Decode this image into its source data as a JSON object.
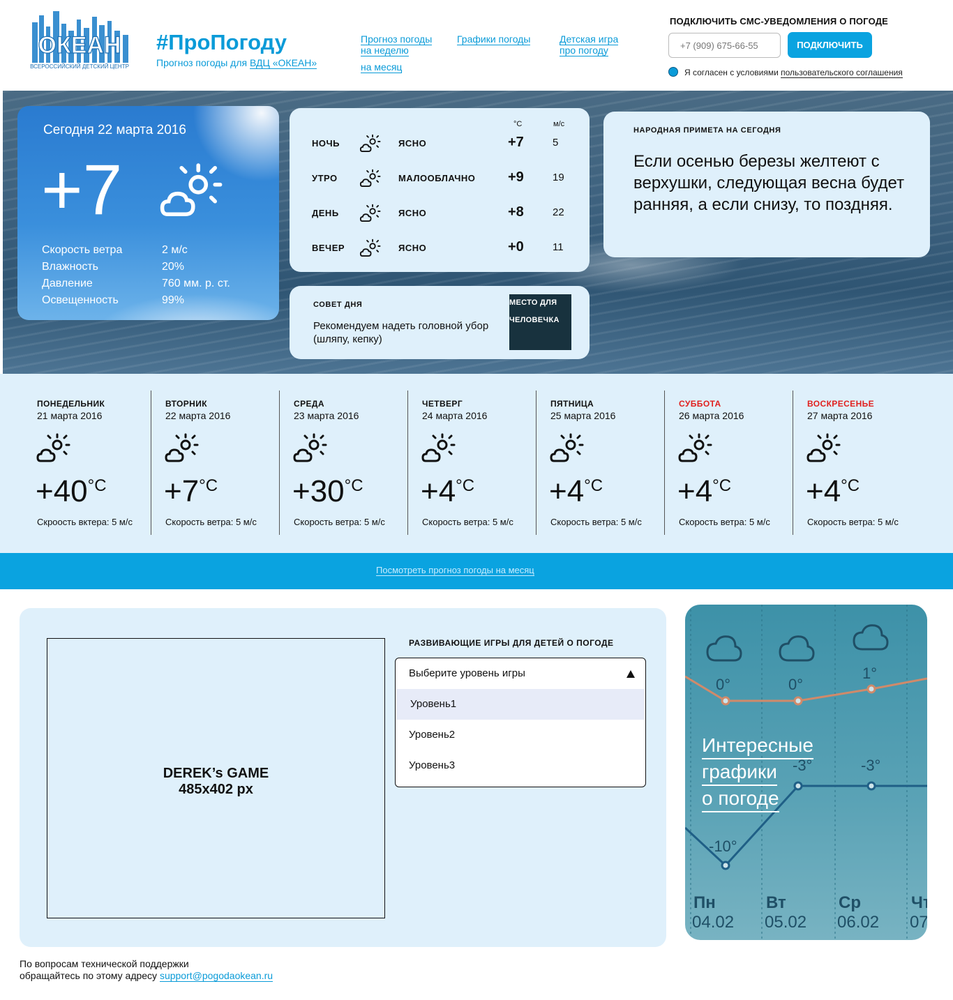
{
  "header": {
    "logo_text": "ОКЕАН",
    "logo_sub": "ВСЕРОССИЙСКИЙ ДЕТСКИЙ ЦЕНТР",
    "hashtag": "#ПроПогоду",
    "subtitle_prefix": "Прогноз погоды для",
    "subtitle_link": "ВДЦ «ОКЕАН»",
    "nav": {
      "week_1": "Прогноз погоды",
      "week_2": "на неделю",
      "month": "на месяц",
      "charts": "Графики погоды",
      "game_1": "Детская игра",
      "game_2": "про погоду"
    },
    "sms": {
      "title": "ПОДКЛЮЧИТЬ СМС-УВЕДОМЛЕНИЯ О ПОГОДЕ",
      "phone_placeholder": "+7 (909) 675-66-55",
      "button": "ПОДКЛЮЧИТЬ",
      "agree_text": "Я согласен с условиями",
      "agree_link": "пользовательского соглашения"
    }
  },
  "today": {
    "date": "Сегодня 22 марта 2016",
    "temp": "+7",
    "rows": [
      {
        "label": "Скорость ветра",
        "value": "2 м/с"
      },
      {
        "label": "Влажность",
        "value": "20%"
      },
      {
        "label": "Давление",
        "value": "760 мм. р. ст."
      },
      {
        "label": "Освещенность",
        "value": "99%"
      }
    ]
  },
  "dayparts": {
    "unit_temp": "°C",
    "unit_wind": "м/с",
    "rows": [
      {
        "name": "НОЧЬ",
        "desc": "ЯСНО",
        "temp": "+7",
        "wind": "5"
      },
      {
        "name": "УТРО",
        "desc": "МАЛООБЛАЧНО",
        "temp": "+9",
        "wind": "19"
      },
      {
        "name": "ДЕНЬ",
        "desc": "ЯСНО",
        "temp": "+8",
        "wind": "22"
      },
      {
        "name": "ВЕЧЕР",
        "desc": "ЯСНО",
        "temp": "+0",
        "wind": "11"
      }
    ]
  },
  "sign": {
    "label": "НАРОДНАЯ ПРИМЕТА НА СЕГОДНЯ",
    "text": "Если осенью березы желтеют с верхушки, следующая весна будет ранняя, а если снизу, то поздняя."
  },
  "advice": {
    "label": "СОВЕТ ДНЯ",
    "text": "Рекомендуем надеть головной убор (шляпу, кепку)",
    "placeholder_1": "МЕСТО ДЛЯ",
    "placeholder_2": "ЧЕЛОВЕЧКА"
  },
  "week": [
    {
      "name": "ПОНЕДЕЛЬНИК",
      "date": "21 марта 2016",
      "temp": "+40",
      "unit": "°C",
      "wind": "Скроость вктера: 5 м/с",
      "weekend": false
    },
    {
      "name": "ВТОРНИК",
      "date": "22 марта 2016",
      "temp": "+7",
      "unit": "°C",
      "wind": "Скорость ветра: 5 м/с",
      "weekend": false
    },
    {
      "name": "СРЕДА",
      "date": "23 марта 2016",
      "temp": "+30",
      "unit": "°C",
      "wind": "Скорость ветра: 5 м/с",
      "weekend": false
    },
    {
      "name": "ЧЕТВЕРГ",
      "date": "24 марта 2016",
      "temp": "+4",
      "unit": "°C",
      "wind": "Скорость ветра: 5 м/с",
      "weekend": false
    },
    {
      "name": "ПЯТНИЦА",
      "date": "25 марта 2016",
      "temp": "+4",
      "unit": "°C",
      "wind": "Скорость ветра: 5 м/с",
      "weekend": false
    },
    {
      "name": "СУББОТА",
      "date": "26 марта 2016",
      "temp": "+4",
      "unit": "°C",
      "wind": "Скорость ветра: 5 м/с",
      "weekend": true
    },
    {
      "name": "ВОСКРЕСЕНЬЕ",
      "date": "27 марта 2016",
      "temp": "+4",
      "unit": "°C",
      "wind": "Скорость ветра: 5 м/с",
      "weekend": true
    }
  ],
  "month_link": "Посмотреть прогноз погоды на месяц",
  "game": {
    "area_1": "DEREK’s GAME",
    "area_2": "485x402 px",
    "title": "РАЗВИВАЮЩИЕ ИГРЫ ДЛЯ ДЕТЕЙ О ПОГОДЕ",
    "select_placeholder": "Выберите уровень игры",
    "options": [
      "Уровень1",
      "Уровень2",
      "Уровень3"
    ]
  },
  "charts_promo": {
    "line_1": "Интересные",
    "line_2": "графики",
    "line_3": "о погоде",
    "bg_labels": [
      "0°",
      "0°",
      "1°",
      "-3°",
      "-3°",
      "-10°",
      "Пн",
      "Вт",
      "Ср",
      "Чт",
      "04.02",
      "05.02",
      "06.02",
      "07"
    ]
  },
  "footer": {
    "line_1": "По вопросам технической поддержки",
    "line_2": "обращайтесь по этому адресу",
    "email": "support@pogodaokean.ru"
  },
  "colors": {
    "accent": "#0aa3e0",
    "panel": "#dff0fb",
    "weekend": "#e0211f"
  }
}
